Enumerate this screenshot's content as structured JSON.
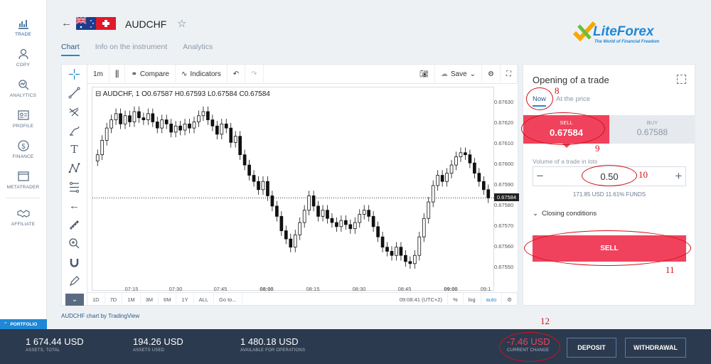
{
  "nav": [
    {
      "label": "TRADE",
      "icon": "chart-icon"
    },
    {
      "label": "COPY",
      "icon": "copy-user-icon"
    },
    {
      "label": "ANALYTICS",
      "icon": "analytics-icon"
    },
    {
      "label": "PROFILE",
      "icon": "profile-card-icon"
    },
    {
      "label": "FINANCE",
      "icon": "dollar-coin-icon"
    },
    {
      "label": "METATRADER",
      "icon": "window-icon"
    },
    {
      "label": "AFFILIATE",
      "icon": "handshake-icon"
    }
  ],
  "portfolio_label": "PORTFOLIO",
  "header": {
    "symbol": "AUDCHF",
    "tabs": [
      "Chart",
      "Info on the instrument",
      "Analytics"
    ],
    "logo_brand": "LiteForex",
    "logo_tagline": "The World of Financial Freedom"
  },
  "chart_toolbar": {
    "interval": "1m",
    "compare": "Compare",
    "indicators": "Indicators",
    "save": "Save"
  },
  "chart_bottom": {
    "ranges": [
      "1D",
      "7D",
      "1M",
      "3M",
      "6M",
      "1Y",
      "ALL"
    ],
    "goto": "Go to...",
    "time": "09:08:41 (UTC+2)",
    "percent": "%",
    "log": "log",
    "auto": "auto"
  },
  "credit": "AUDCHF chart by TradingView",
  "chart_data": {
    "type": "candlestick",
    "symbol": "AUDCHF",
    "interval": "1",
    "ohlc_legend": {
      "O": "0.67587",
      "H": "0.67593",
      "L": "0.67584",
      "C": "0.67584"
    },
    "last_price": "0.67584",
    "y_ticks": [
      "0.67630",
      "0.67620",
      "0.67610",
      "0.67600",
      "0.67590",
      "0.67580",
      "0.67570",
      "0.67560",
      "0.67550"
    ],
    "ylim": [
      0.67545,
      0.67635
    ],
    "x_ticks": [
      "07:15",
      "07:30",
      "07:45",
      "08:00",
      "08:15",
      "08:30",
      "08:45",
      "09:00",
      "09:1"
    ],
    "close_series": [
      0.67605,
      0.67612,
      0.67618,
      0.67622,
      0.67625,
      0.6762,
      0.67624,
      0.67621,
      0.67626,
      0.67623,
      0.67622,
      0.67625,
      0.67621,
      0.67618,
      0.67622,
      0.6762,
      0.67616,
      0.67619,
      0.67617,
      0.6762,
      0.67618,
      0.67621,
      0.67624,
      0.67626,
      0.67622,
      0.67619,
      0.67615,
      0.6762,
      0.67618,
      0.67611,
      0.67614,
      0.67605,
      0.676,
      0.67595,
      0.67592,
      0.67588,
      0.67592,
      0.67585,
      0.6758,
      0.67575,
      0.67568,
      0.67564,
      0.6756,
      0.67566,
      0.67572,
      0.67578,
      0.67585,
      0.6758,
      0.67575,
      0.67578,
      0.67574,
      0.67572,
      0.6757,
      0.67573,
      0.67571,
      0.67569,
      0.67572,
      0.67576,
      0.67578,
      0.67575,
      0.6757,
      0.67565,
      0.6756,
      0.67558,
      0.67556,
      0.6756,
      0.67556,
      0.67553,
      0.67552,
      0.67556,
      0.67565,
      0.67574,
      0.67582,
      0.6759,
      0.67595,
      0.67592,
      0.67596,
      0.676,
      0.67604,
      0.67606,
      0.67605,
      0.67601,
      0.67596,
      0.67592,
      0.67588,
      0.67584
    ]
  },
  "order": {
    "title": "Opening of a trade",
    "tab_now": "Now",
    "tab_price": "At the price",
    "sell_label": "SELL",
    "sell_price": "0.67584",
    "buy_label": "BUY",
    "buy_price": "0.67588",
    "volume_label": "Volume of a trade in lots",
    "volume": "0.50",
    "volume_usd": "171.85 USD",
    "volume_funds": "11.61% FUNDS",
    "closing": "Closing conditions",
    "sell_button": "SELL"
  },
  "annotations": {
    "a8": "8",
    "a9": "9",
    "a10": "10",
    "a11": "11",
    "a12": "12"
  },
  "footer": {
    "assets_total": "1 674.44 USD",
    "assets_total_label": "ASSETS, TOTAL",
    "assets_used": "194.26 USD",
    "assets_used_label": "ASSETS USED",
    "available": "1 480.18 USD",
    "available_label": "AVAILABLE FOR OPERATIONS",
    "current_change": "-7.46 USD",
    "current_change_label": "CURRENT CHANGE",
    "deposit": "DEPOSIT",
    "withdrawal": "WITHDRAWAL"
  },
  "colors": {
    "accent": "#1e88d6",
    "sell": "#f0425c",
    "footer_bg": "#2b3a4e",
    "annotation": "#d0121b",
    "negative": "#f0425c"
  }
}
